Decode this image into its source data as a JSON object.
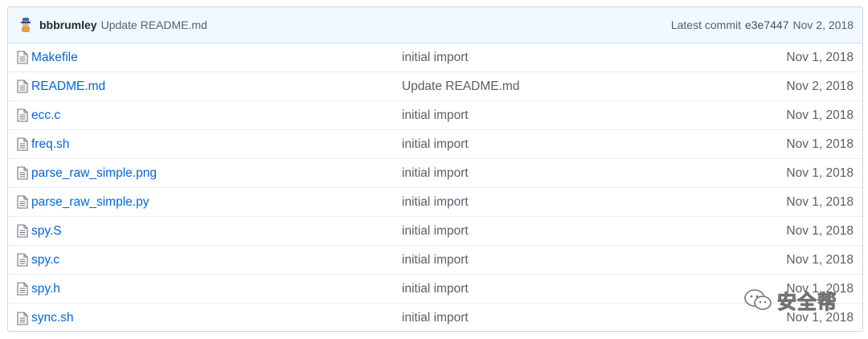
{
  "commit": {
    "author": "bbbrumley",
    "message": "Update README.md",
    "latest_label": "Latest commit",
    "sha": "e3e7447",
    "date": "Nov 2, 2018"
  },
  "files": [
    {
      "name": "Makefile",
      "commit": "initial import",
      "date": "Nov 1, 2018"
    },
    {
      "name": "README.md",
      "commit": "Update README.md",
      "date": "Nov 2, 2018"
    },
    {
      "name": "ecc.c",
      "commit": "initial import",
      "date": "Nov 1, 2018"
    },
    {
      "name": "freq.sh",
      "commit": "initial import",
      "date": "Nov 1, 2018"
    },
    {
      "name": "parse_raw_simple.png",
      "commit": "initial import",
      "date": "Nov 1, 2018"
    },
    {
      "name": "parse_raw_simple.py",
      "commit": "initial import",
      "date": "Nov 1, 2018"
    },
    {
      "name": "spy.S",
      "commit": "initial import",
      "date": "Nov 1, 2018"
    },
    {
      "name": "spy.c",
      "commit": "initial import",
      "date": "Nov 1, 2018"
    },
    {
      "name": "spy.h",
      "commit": "initial import",
      "date": "Nov 1, 2018"
    },
    {
      "name": "sync.sh",
      "commit": "initial import",
      "date": "Nov 1, 2018"
    }
  ],
  "watermark": {
    "text": "安全帮",
    "icon": "wechat-icon"
  },
  "colors": {
    "link": "#0366d6",
    "muted": "#586069",
    "commit_bar_bg": "#f1f8ff",
    "border": "#d1d5da"
  }
}
